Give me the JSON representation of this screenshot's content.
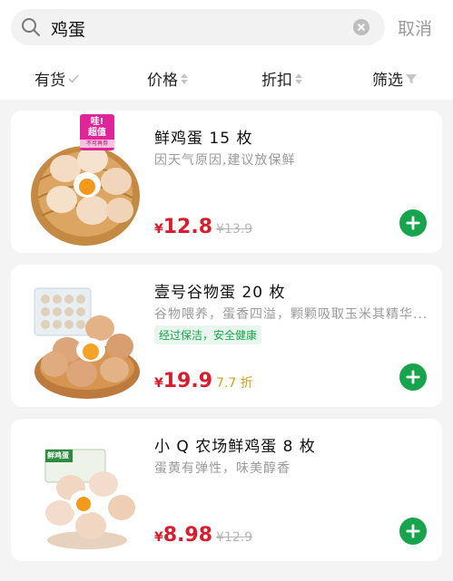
{
  "search": {
    "query": "鸡蛋",
    "cancel_label": "取消"
  },
  "filters": [
    {
      "label": "有货",
      "icon": "check-icon"
    },
    {
      "label": "价格",
      "icon": "sort-arrows-icon"
    },
    {
      "label": "折扣",
      "icon": "sort-arrows-icon"
    },
    {
      "label": "筛选",
      "icon": "funnel-icon"
    }
  ],
  "colors": {
    "price_red": "#d81e2e",
    "add_green": "#18a44c",
    "badge_pink": "#e0249a"
  },
  "products": [
    {
      "title": "鲜鸡蛋 15 枚",
      "desc": "因天气原因,建议放保鲜",
      "price_currency": "¥",
      "price": "12.8",
      "original_price": "¥13.9",
      "badge": {
        "line1": "哇!",
        "line2": "超值",
        "line3": "不可再劵"
      }
    },
    {
      "title": "壹号谷物蛋 20 枚",
      "desc": "谷物喂养，蛋香四溢，颗颗吸取玉米其精华...",
      "tag": "经过保洁，安全健康",
      "price_currency": "¥",
      "price": "19.9",
      "discount": "7.7 折"
    },
    {
      "title": "小 Q 农场鲜鸡蛋 8 枚",
      "desc": "蛋黄有弹性，味美醇香",
      "price_currency": "¥",
      "price": "8.98",
      "original_price": "¥12.9",
      "package_label": "鲜鸡蛋"
    }
  ]
}
